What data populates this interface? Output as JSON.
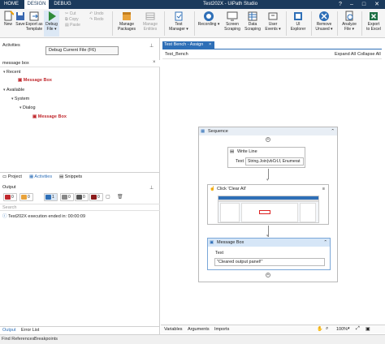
{
  "app": {
    "title": "Test202X - UiPath Studio",
    "tabs": [
      "HOME",
      "DESIGN",
      "DEBUG"
    ],
    "active_tab": "DESIGN",
    "window_controls": [
      "?",
      "–",
      "□",
      "✕"
    ]
  },
  "ribbon": {
    "new": "New",
    "save": "Save",
    "export_template_1": "Export as",
    "export_template_2": "Template",
    "debug_file_1": "Debug",
    "debug_file_2": "File ▾",
    "cut": "Cut",
    "copy": "Copy",
    "paste": "Paste",
    "undo": "Undo",
    "redo": "Redo",
    "manage_packages_1": "Manage",
    "manage_packages_2": "Packages",
    "manage_entities_1": "Manage",
    "manage_entities_2": "Entities",
    "test_manager_1": "Test",
    "test_manager_2": "Manager ▾",
    "recording": "Recording ▾",
    "screen_scraping_1": "Screen",
    "screen_scraping_2": "Scraping",
    "data_scraping_1": "Data",
    "data_scraping_2": "Scraping",
    "user_events_1": "User",
    "user_events_2": "Events ▾",
    "ui_explorer_1": "UI",
    "ui_explorer_2": "Explorer",
    "remove_unused_1": "Remove",
    "remove_unused_2": "Unused ▾",
    "analyze_file_1": "Analyze",
    "analyze_file_2": "File ▾",
    "export_excel_1": "Export",
    "export_excel_2": "to Excel"
  },
  "tooltip": "Debug Current File (F6)",
  "activities": {
    "title": "Activities",
    "search_value": "message box",
    "recent_label": "Recent",
    "recent_item": "Message Box",
    "available_label": "Available",
    "system_label": "System",
    "dialog_label": "Dialog",
    "dialog_item": "Message Box"
  },
  "panel_tabs": [
    "Project",
    "Activities",
    "Snippets"
  ],
  "output": {
    "title": "Output",
    "badges": [
      "0",
      "0",
      "1",
      "0",
      "0",
      "0"
    ],
    "search_placeholder": "Search",
    "log_line": "Test202X execution ended in: 00:00:09"
  },
  "bottom_left_tabs": [
    "Output",
    "Error List"
  ],
  "footer_tabs": [
    "Find References",
    "Breakpoints"
  ],
  "designer": {
    "doc_tab": "Test Bench - Assign",
    "breadcrumb": "Test_Bench",
    "expand_all": "Expand All",
    "collapse_all": "Collapse All",
    "sequence": "Sequence",
    "write_line": "Write Line",
    "write_line_text_label": "Text",
    "write_line_text_value": "String.Join(vbCrLf, Enumerat",
    "click_activity": "Click 'Clear All'",
    "message_box": "Message Box",
    "message_box_text_label": "Text",
    "message_box_text_value": "\"Cleared output panel!\""
  },
  "designer_footer": {
    "tabs": [
      "Variables",
      "Arguments",
      "Imports"
    ],
    "zoom": "100%"
  }
}
